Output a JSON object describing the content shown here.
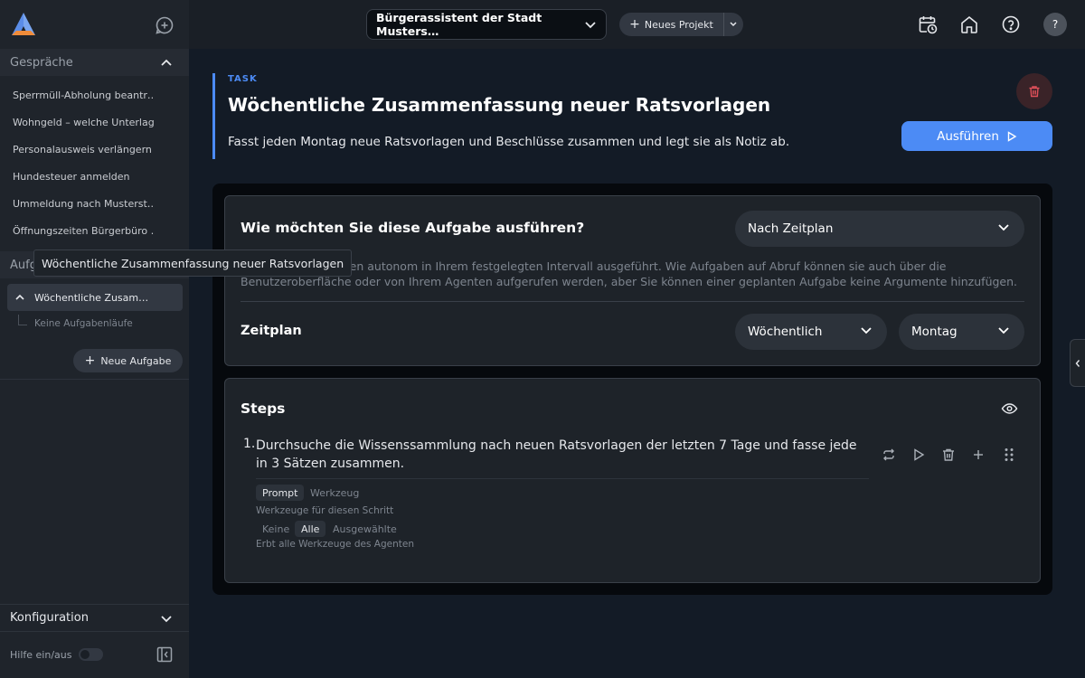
{
  "sidebar": {
    "conversations_header": "Gespräche",
    "conversations": [
      "Sperrmüll-Abholung beantr…",
      "Wohngeld – welche Unterlag…",
      "Personalausweis verlängern",
      "Hundesteuer anmelden",
      "Ummeldung nach Musterst…",
      "Öffnungszeiten Bürgerbüro …"
    ],
    "tasks_header": "Aufg",
    "active_task": "Wöchentliche Zusam…",
    "task_runs": "Keine Aufgabenläufe",
    "new_task_label": "Neue Aufgabe",
    "config_header": "Konfiguration",
    "help_toggle_label": "Hilfe ein/aus"
  },
  "tooltip": "Wöchentliche Zusammenfassung neuer Ratsvorlagen",
  "topbar": {
    "assistant_name": "Bürgerassistent der Stadt Musters…",
    "new_project_label": "Neues Projekt",
    "avatar_label": "?"
  },
  "task": {
    "label": "TASK",
    "title": "Wöchentliche Zusammenfassung neuer Ratsvorlagen",
    "description": "Fasst jeden Montag neue Ratsvorlagen und Beschlüsse zusammen und legt sie als Notiz ab.",
    "run_label": "Ausführen"
  },
  "execution": {
    "question": "Wie möchten Sie diese Aufgabe ausführen?",
    "mode_value": "Nach Zeitplan",
    "info_line1": "n werden autonom in Ihrem festgelegten Intervall ausgeführt. Wie Aufgaben auf Abruf können sie auch über die",
    "info_line2": "Benutzeroberfläche oder von Ihrem Agenten aufgerufen werden, aber Sie können einer geplanten Aufgabe keine Argumente hinzufügen.",
    "schedule_label": "Zeitplan",
    "frequency_value": "Wöchentlich",
    "day_value": "Montag"
  },
  "steps": {
    "title": "Steps",
    "items": [
      {
        "number": "1.",
        "text": "Durchsuche die Wissenssammlung nach neuen Ratsvorlagen der letzten 7 Tage und fasse jede in 3 Sätzen zusammen.",
        "mode_prompt": "Prompt",
        "mode_tool": "Werkzeug",
        "tools_label": "Werkzeuge für diesen Schritt",
        "tools_none": "Keine",
        "tools_all": "Alle",
        "tools_selected": "Ausgewählte",
        "inherit_note": "Erbt alle Werkzeuge des Agenten"
      }
    ]
  },
  "colors": {
    "accent": "#4c8bf5",
    "danger": "#e0505a",
    "background": "#131b26",
    "sidebar": "#1f242b"
  }
}
